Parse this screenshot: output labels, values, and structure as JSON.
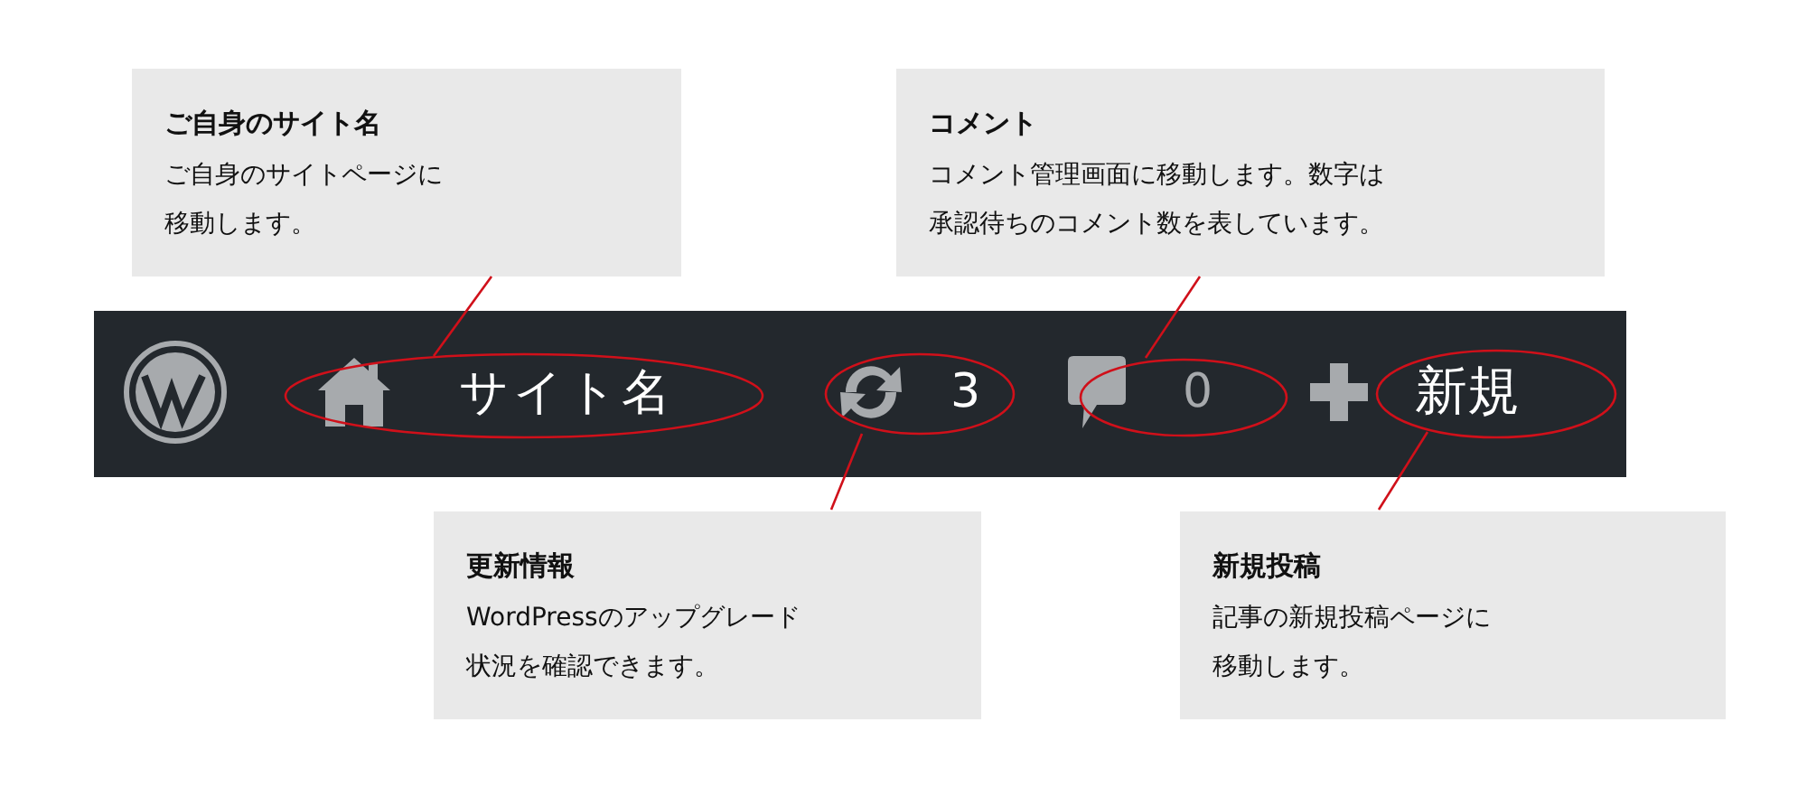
{
  "top_callouts": [
    {
      "title": "ご自身のサイト名",
      "lines": [
        "ご自身のサイトページに",
        "移動します。"
      ]
    },
    {
      "title": "コメント",
      "lines": [
        "コメント管理画面に移動します。数字は",
        "承認待ちのコメント数を表しています。"
      ]
    }
  ],
  "admin_bar": {
    "items": [
      {
        "kind": "logo"
      },
      {
        "kind": "site",
        "label": "サイト名"
      },
      {
        "kind": "updates",
        "label": "3"
      },
      {
        "kind": "comments",
        "label": "0"
      },
      {
        "kind": "new",
        "label": "新規"
      }
    ]
  },
  "bottom_callouts": [
    {
      "title": "更新情報",
      "lines": [
        "WordPressのアップグレード",
        "状況を確認できます。"
      ]
    },
    {
      "title": "新規投稿",
      "lines": [
        "記事の新規投稿ページに",
        "移動します。"
      ]
    }
  ]
}
